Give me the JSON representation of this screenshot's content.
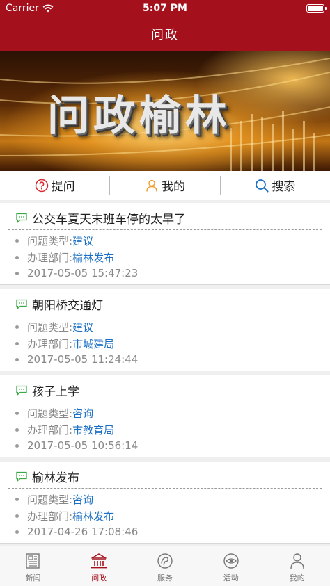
{
  "status_bar": {
    "carrier": "Carrier",
    "time": "5:07 PM",
    "battery_level": 1.0
  },
  "nav": {
    "title": "问政"
  },
  "banner": {
    "title": "问政榆林"
  },
  "actions": [
    {
      "label": "提问",
      "icon": "question-circle-icon",
      "color": "#d9282f"
    },
    {
      "label": "我的",
      "icon": "person-icon",
      "color": "#f0a030"
    },
    {
      "label": "搜索",
      "icon": "search-icon",
      "color": "#1a6fc4"
    }
  ],
  "list": {
    "type_label": "问题类型:",
    "dept_label": "办理部门:",
    "items": [
      {
        "title": "公交车夏天末班车停的太早了",
        "type": "建议",
        "dept": "榆林发布",
        "time": "2017-05-05 15:47:23"
      },
      {
        "title": "朝阳桥交通灯",
        "type": "建议",
        "dept": "市城建局",
        "time": "2017-05-05 11:24:44"
      },
      {
        "title": "孩子上学",
        "type": "咨询",
        "dept": "市教育局",
        "time": "2017-05-05 10:56:14"
      },
      {
        "title": "榆林发布",
        "type": "咨询",
        "dept": "榆林发布",
        "time": "2017-04-26 17:08:46"
      }
    ]
  },
  "tabs": [
    {
      "label": "新闻",
      "icon": "newspaper-icon",
      "active": false
    },
    {
      "label": "问政",
      "icon": "government-building-icon",
      "active": true
    },
    {
      "label": "服务",
      "icon": "service-icon",
      "active": false
    },
    {
      "label": "活动",
      "icon": "eye-icon",
      "active": false
    },
    {
      "label": "我的",
      "icon": "person-icon",
      "active": false
    }
  ],
  "colors": {
    "brand": "#a4111d",
    "link": "#1a6fc4",
    "bubble": "#3aa845"
  }
}
